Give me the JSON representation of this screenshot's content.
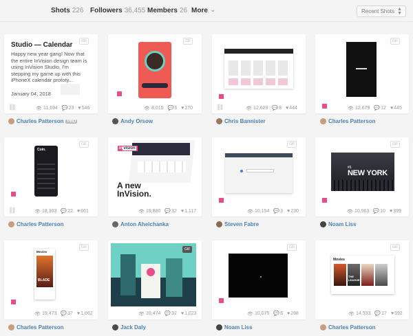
{
  "nav": {
    "shots_label": "Shots",
    "shots_count": "226",
    "followers_label": "Followers",
    "followers_count": "36,455",
    "members_label": "Members",
    "members_count": "26",
    "more_label": "More",
    "sort_value": "Recent Shots"
  },
  "card1": {
    "title": "Studio — Calendar",
    "body": "Happy new year gang! Now that the entire InVision design team is using InVision Studio, I'm stepping my game up with this iPhoneX calendar prototy...",
    "date": "January 04, 2018"
  },
  "mini": {
    "app_title": "Coin.",
    "invision_logo": "in",
    "invision_logo_rest": "vision",
    "invision_a_new": "A new",
    "invision_name": "InVision.",
    "ny_line1": "#1",
    "ny_line2": "NEW YORK",
    "movies_label": "Movies",
    "movies_label2": "Movies",
    "poster1": "BLADE",
    "poster2": "THE",
    "poster3": "LEAGUE"
  },
  "gif_label": "GIF",
  "pro_label": "PRO",
  "shots": [
    {
      "views": "11,694",
      "comments": "23",
      "likes": "546",
      "author": "Charles Patterson"
    },
    {
      "views": "8,015",
      "comments": "6",
      "likes": "270",
      "author": "Andy Orsow"
    },
    {
      "views": "12,629",
      "comments": "8",
      "likes": "444",
      "author": "Chris Bannister"
    },
    {
      "views": "12,679",
      "comments": "12",
      "likes": "445",
      "author": "Charles Patterson"
    },
    {
      "views": "18,303",
      "comments": "22",
      "likes": "661",
      "author": "Charles Patterson"
    },
    {
      "views": "19,880",
      "comments": "32",
      "likes": "1,117",
      "author": "Anton Aheichanka"
    },
    {
      "views": "10,154",
      "comments": "3",
      "likes": "230",
      "author": "Steven Fabre"
    },
    {
      "views": "10,963",
      "comments": "10",
      "likes": "399",
      "author": "Noam Liss"
    },
    {
      "views": "19,473",
      "comments": "37",
      "likes": "1,062",
      "author": "Charles Patterson"
    },
    {
      "views": "20,474",
      "comments": "32",
      "likes": "1,023",
      "author": "Jack Daly"
    },
    {
      "views": "10,075",
      "comments": "8",
      "likes": "288",
      "author": "Noam Liss"
    },
    {
      "views": "14,533",
      "comments": "17",
      "likes": "592",
      "author": "Charles Patterson"
    }
  ],
  "colors": {
    "accent": "#ea4c89",
    "author": "#4a82b6"
  }
}
